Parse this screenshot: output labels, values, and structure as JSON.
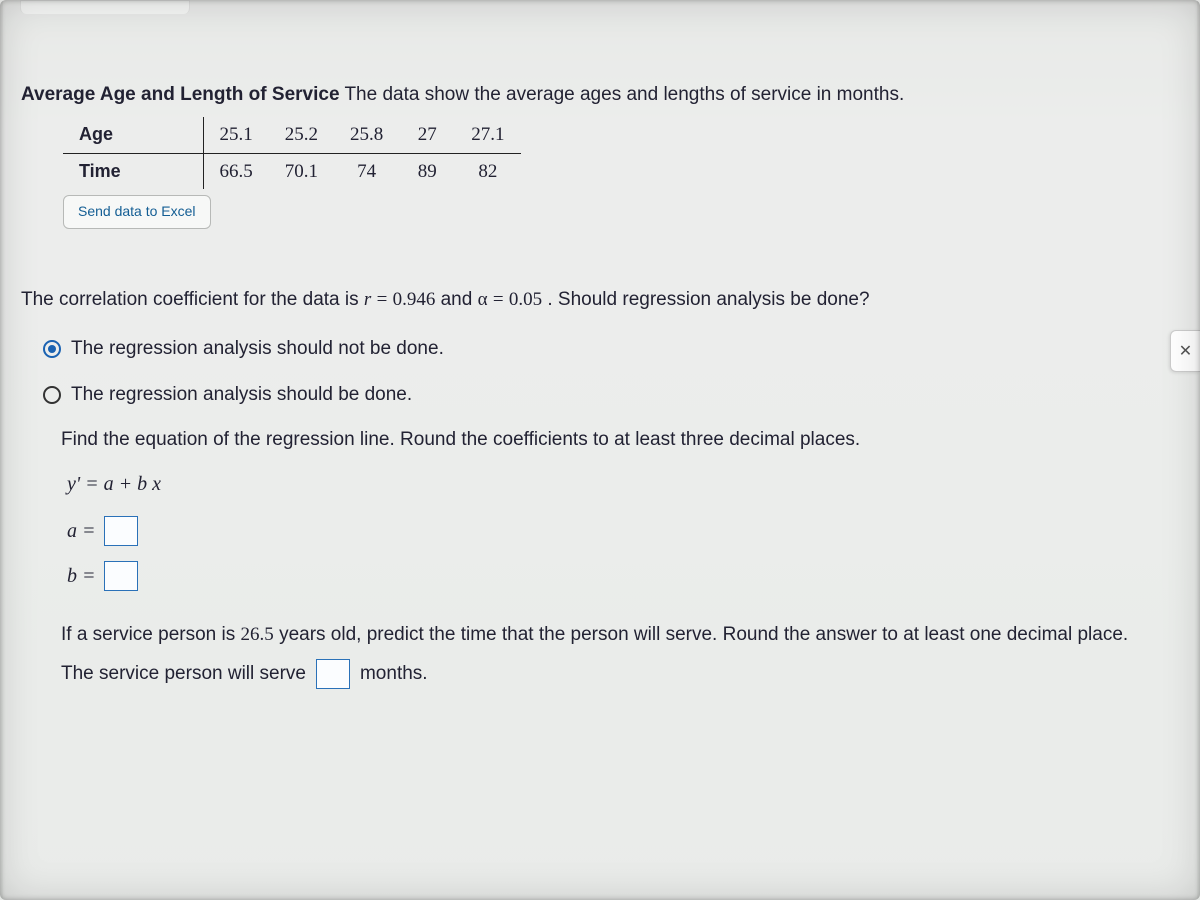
{
  "title": {
    "bold": "Average Age and Length of Service",
    "rest": " The data show the average ages and lengths of service in months."
  },
  "table": {
    "row1_label": "Age",
    "row2_label": "Time",
    "ages": [
      "25.1",
      "25.2",
      "25.8",
      "27",
      "27.1"
    ],
    "times": [
      "66.5",
      "70.1",
      "74",
      "89",
      "82"
    ]
  },
  "excel_button": "Send data to Excel",
  "corr_text": {
    "pre": "The correlation coefficient for the data is ",
    "r_label": "r",
    "eq1": "=",
    "r_val": "0.946",
    "and": " and ",
    "alpha": "α",
    "eq2": "=",
    "alpha_val": "0.05",
    "post": ". Should regression analysis be done?"
  },
  "options": {
    "opt1": "The regression analysis should not be done.",
    "opt2": "The regression analysis should be done."
  },
  "find_line": "Find the equation of the regression line. Round the coefficients to at least three decimal places.",
  "equation": "y' = a + b x",
  "coef_a_label": "a =",
  "coef_b_label": "b =",
  "predict": {
    "pre": "If a service person is ",
    "age": "26.5",
    "post": " years old, predict the time that the person will serve. Round the answer to at least one decimal place."
  },
  "serve_line": {
    "pre": "The service person will serve",
    "post": "months."
  },
  "close_icon": "✕",
  "chart_data": {
    "type": "table",
    "title": "Average Age and Length of Service",
    "columns": [
      "Age",
      "Time"
    ],
    "rows": [
      [
        25.1,
        66.5
      ],
      [
        25.2,
        70.1
      ],
      [
        25.8,
        74
      ],
      [
        27,
        89
      ],
      [
        27.1,
        82
      ]
    ],
    "r": 0.946,
    "alpha": 0.05,
    "predict_x": 26.5
  }
}
